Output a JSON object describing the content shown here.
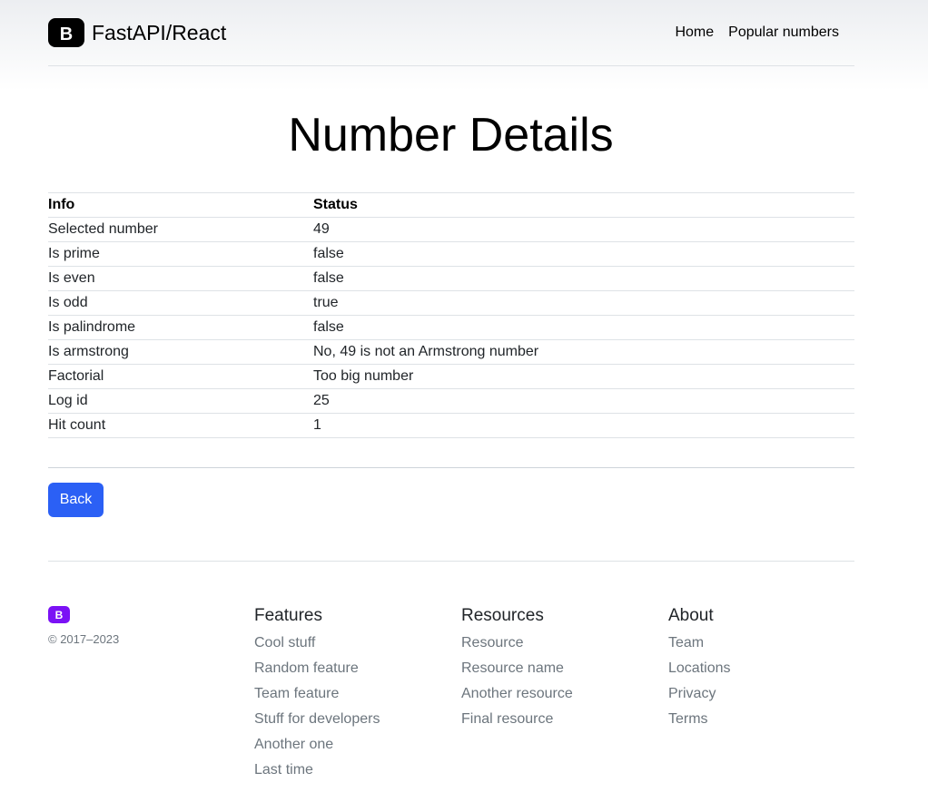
{
  "brand": {
    "name": "FastAPI/React",
    "logo_letter": "B"
  },
  "nav": {
    "links": [
      "Home",
      "Popular numbers"
    ]
  },
  "page": {
    "title": "Number Details"
  },
  "table": {
    "headers": [
      "Info",
      "Status"
    ],
    "rows": [
      [
        "Selected number",
        "49"
      ],
      [
        "Is prime",
        "false"
      ],
      [
        "Is even",
        "false"
      ],
      [
        "Is odd",
        "true"
      ],
      [
        "Is palindrome",
        "false"
      ],
      [
        "Is armstrong",
        "No, 49 is not an Armstrong number"
      ],
      [
        "Factorial",
        "Too big number"
      ],
      [
        "Log id",
        "25"
      ],
      [
        "Hit count",
        "1"
      ]
    ]
  },
  "actions": {
    "back_label": "Back"
  },
  "footer": {
    "copyright": "© 2017–2023",
    "columns": [
      {
        "title": "Features",
        "links": [
          "Cool stuff",
          "Random feature",
          "Team feature",
          "Stuff for developers",
          "Another one",
          "Last time"
        ]
      },
      {
        "title": "Resources",
        "links": [
          "Resource",
          "Resource name",
          "Another resource",
          "Final resource"
        ]
      },
      {
        "title": "About",
        "links": [
          "Team",
          "Locations",
          "Privacy",
          "Terms"
        ]
      }
    ]
  },
  "colors": {
    "primary": "#2b60f5",
    "brand_purple": "#7b12f5",
    "muted": "#6c757d"
  }
}
